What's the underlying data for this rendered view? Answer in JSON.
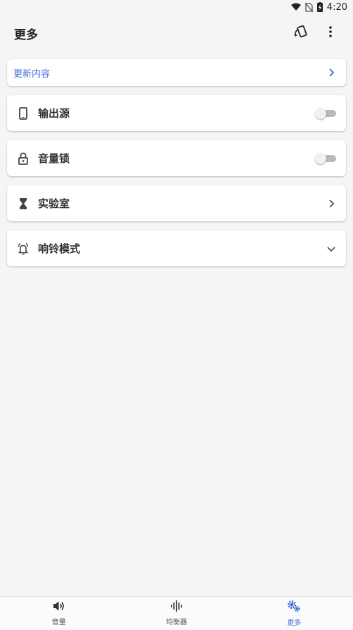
{
  "status_bar": {
    "time": "4:20"
  },
  "app_bar": {
    "title": "更多"
  },
  "update_card": {
    "label": "更新内容"
  },
  "rows": [
    {
      "label": "输出源",
      "icon": "phone-icon",
      "control": "toggle",
      "checked": false
    },
    {
      "label": "音量锁",
      "icon": "lock-icon",
      "control": "toggle",
      "checked": false
    },
    {
      "label": "实验室",
      "icon": "hourglass-icon",
      "control": "chevron-right"
    },
    {
      "label": "响铃模式",
      "icon": "bell-icon",
      "control": "chevron-down"
    }
  ],
  "bottom_nav": {
    "items": [
      {
        "label": "音量",
        "icon": "volume-icon",
        "active": false
      },
      {
        "label": "均衡器",
        "icon": "equalizer-icon",
        "active": false
      },
      {
        "label": "更多",
        "icon": "settings-gears-icon",
        "active": true
      }
    ]
  },
  "colors": {
    "accent": "#3f6fd8",
    "background": "#f5f5f5"
  }
}
